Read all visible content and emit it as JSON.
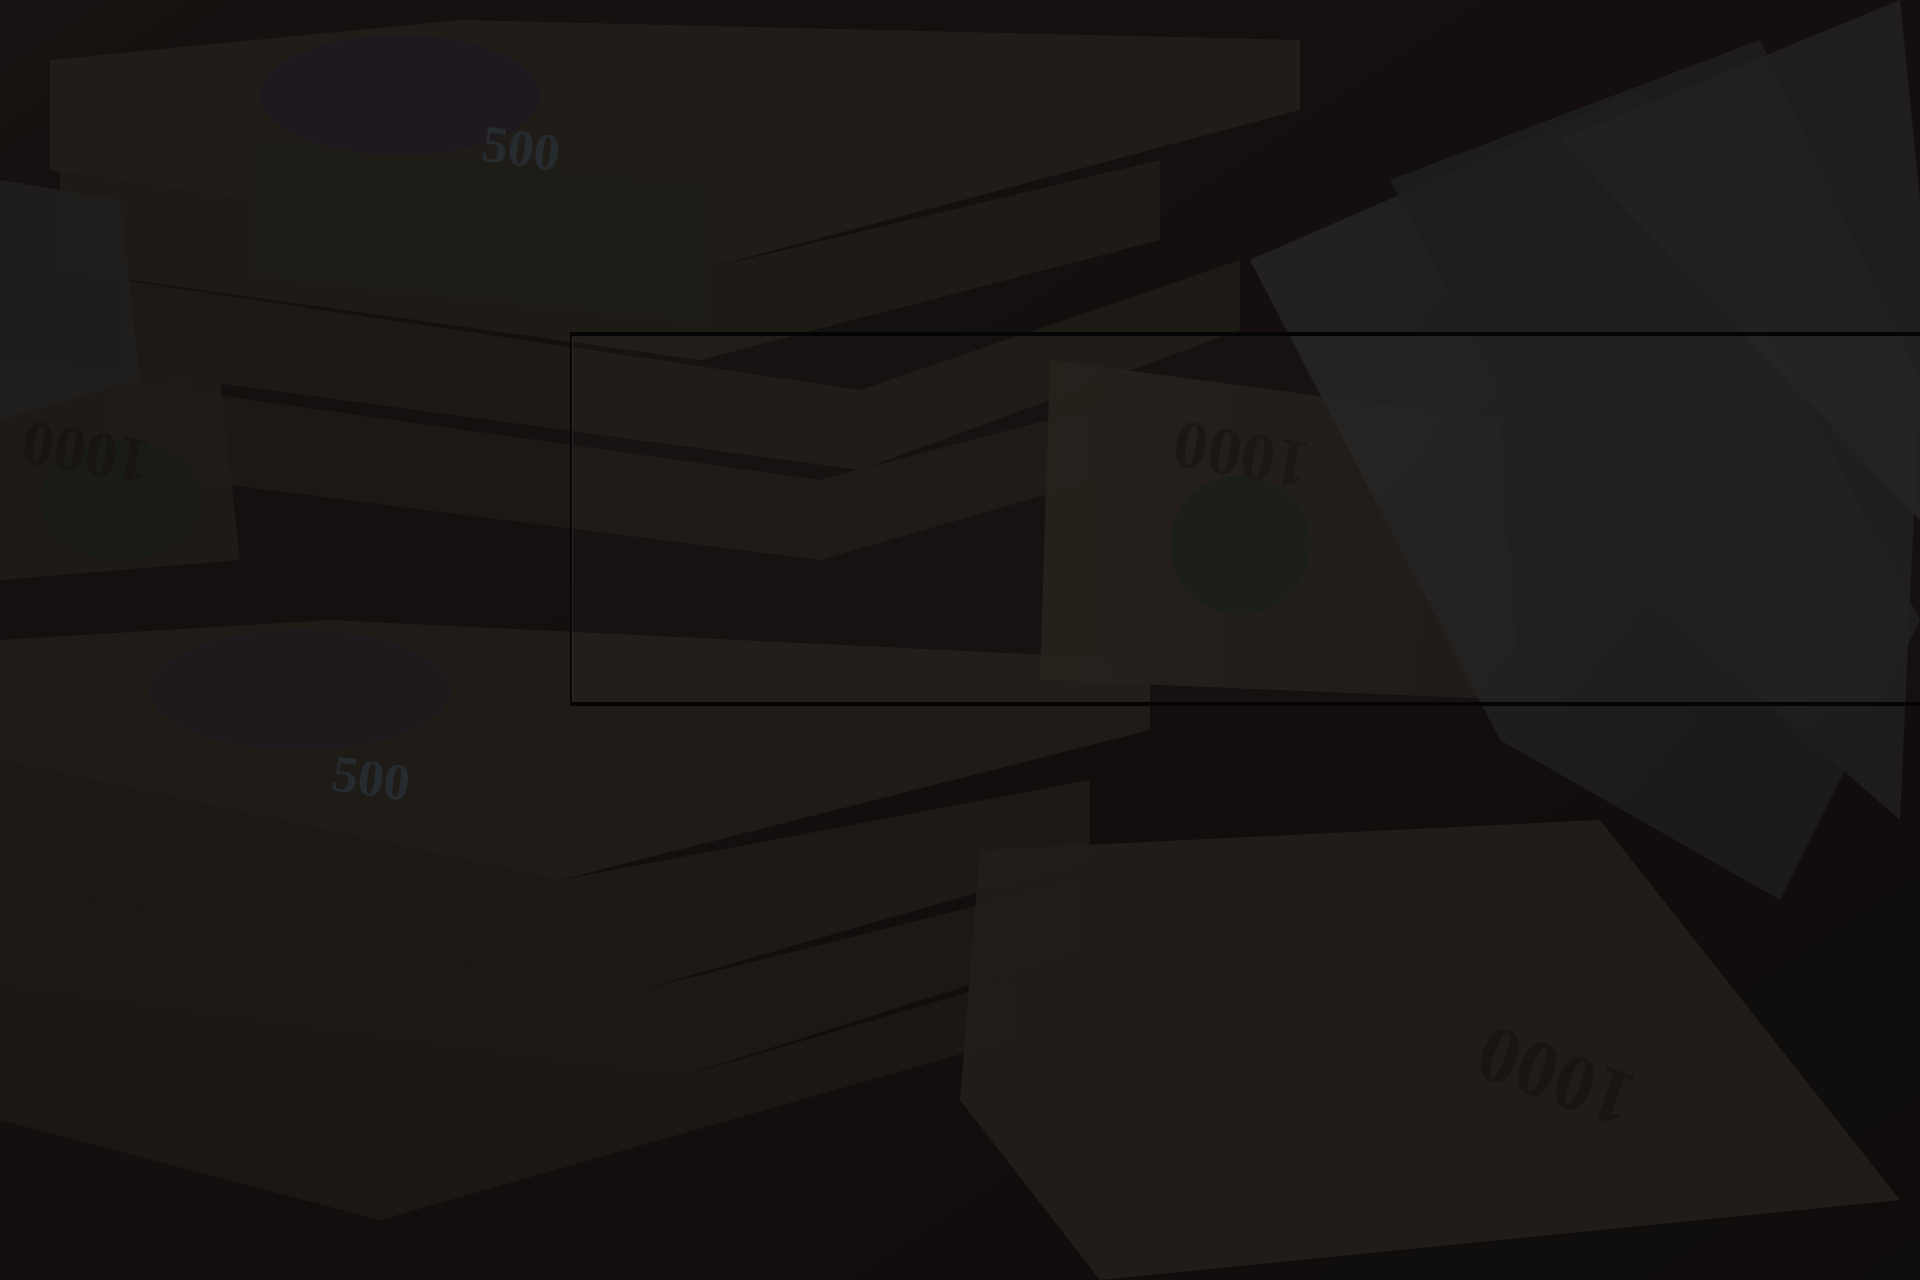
{
  "background": {
    "description_tags": [
      "banknote-stacks",
      "banknote-fan"
    ],
    "note_denominations": {
      "stack_upper": "500",
      "stack_lower": "500",
      "loose_note_left": "1000",
      "loose_note_center": "1000",
      "loose_note_bottom": "1000"
    },
    "overlay_color": "#141010"
  },
  "hero": {
    "title": "",
    "subtitle": ""
  }
}
